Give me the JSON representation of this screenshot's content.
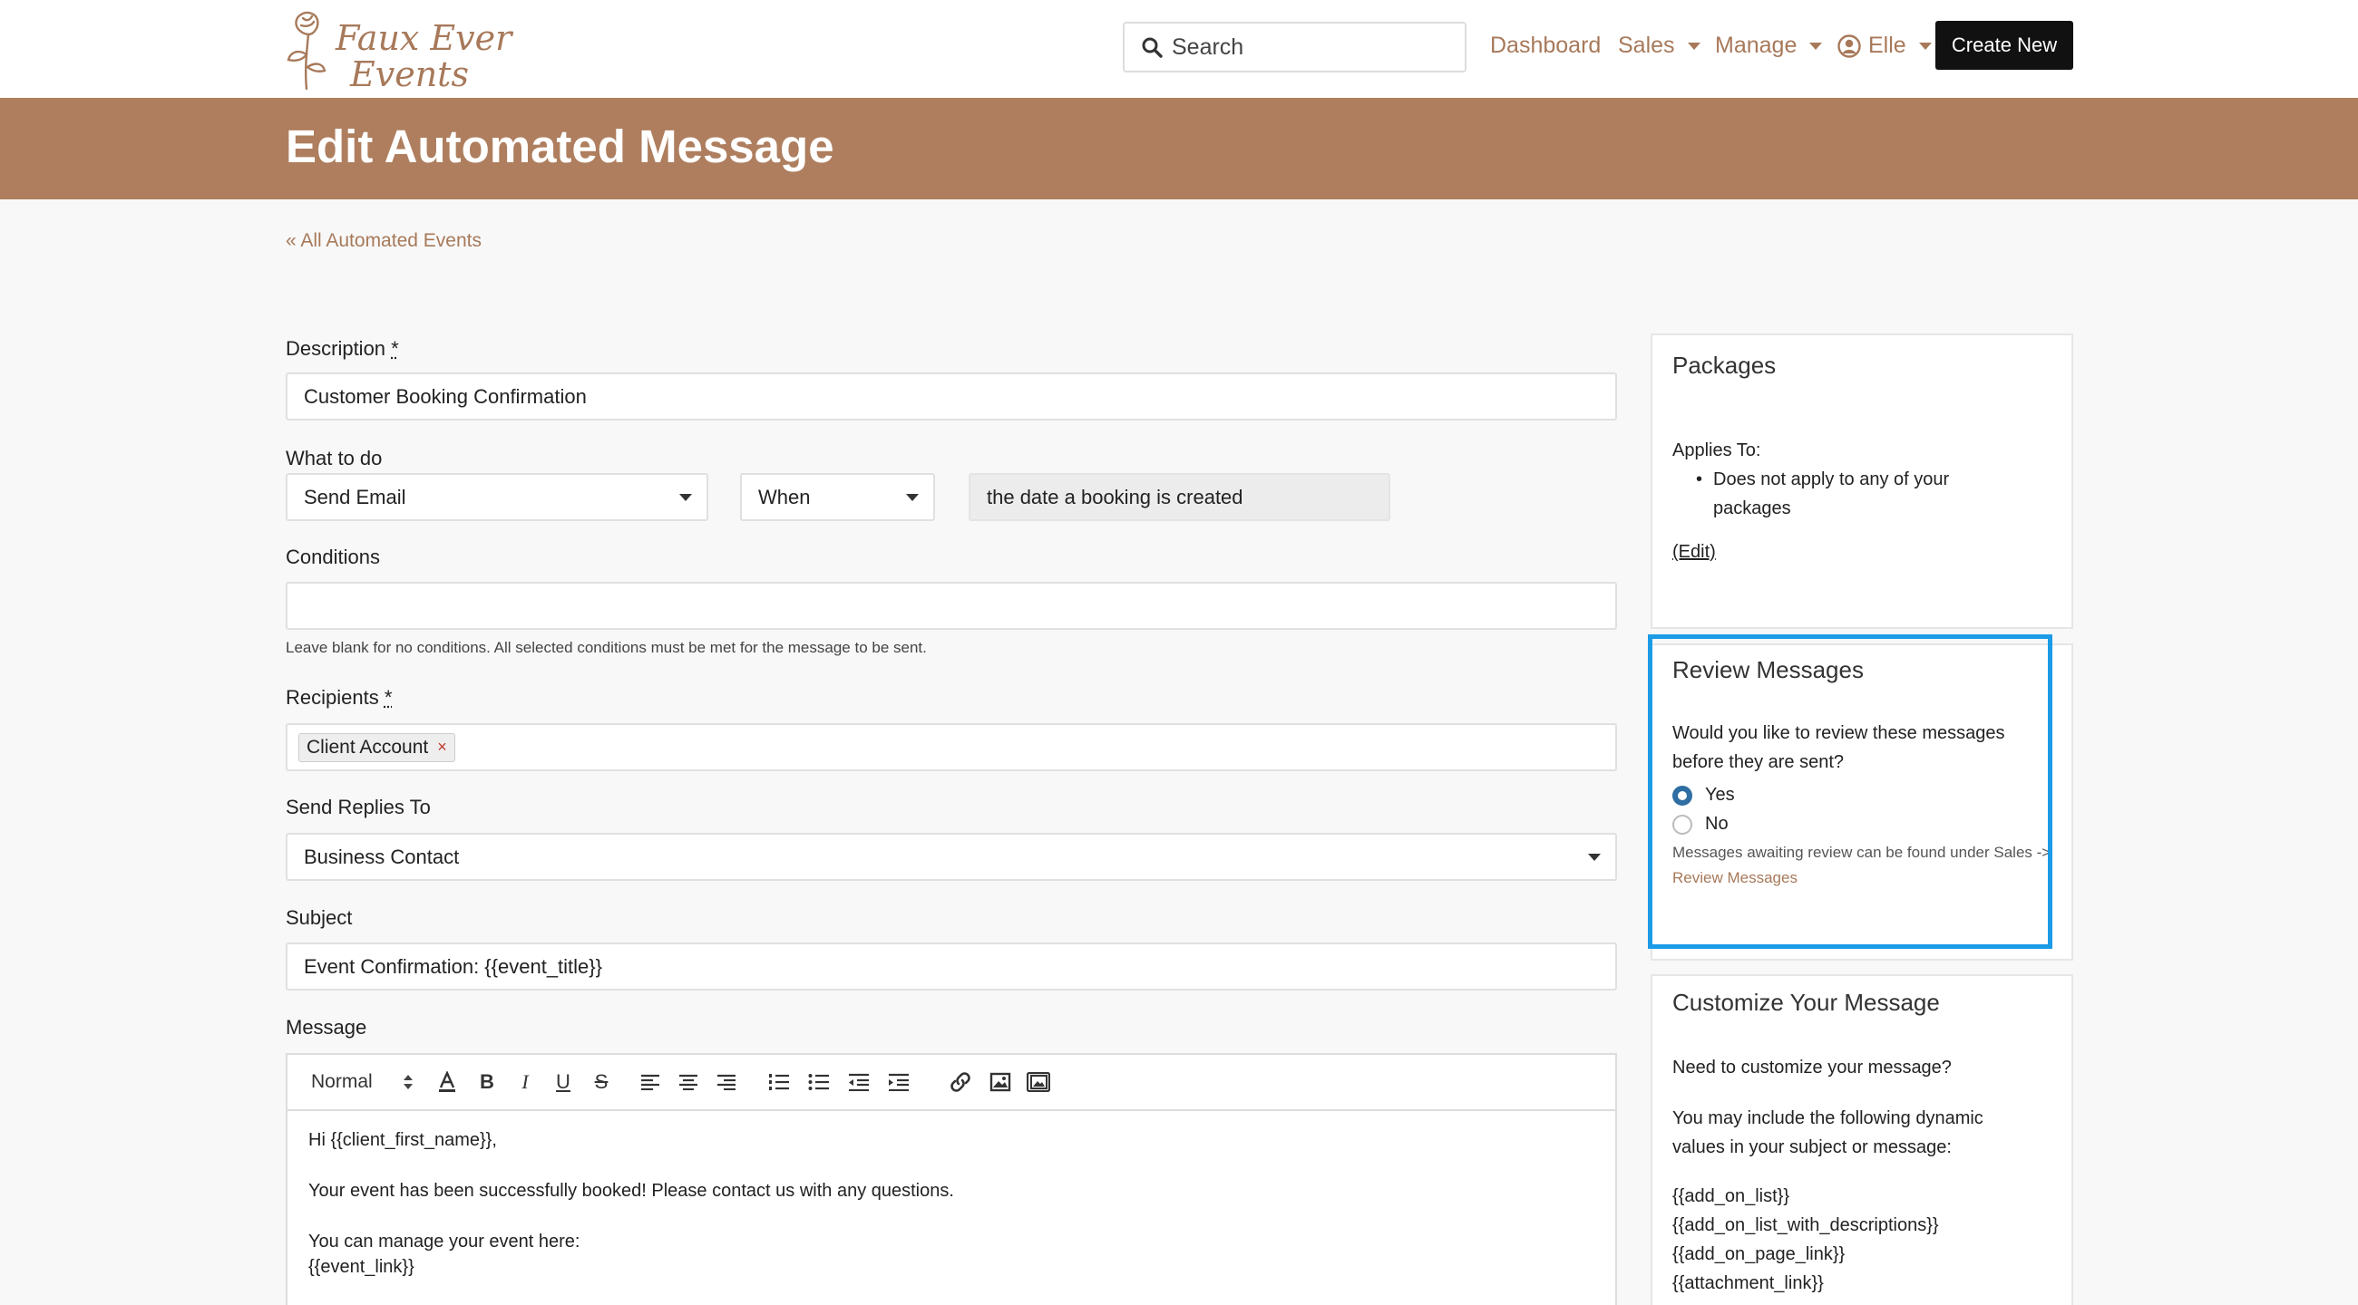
{
  "brand": {
    "logo_line1": "Faux Ever",
    "logo_line2": "Events"
  },
  "nav": {
    "search_placeholder": "Search",
    "dashboard": "Dashboard",
    "sales": "Sales",
    "manage": "Manage",
    "user": "Elle",
    "create_new": "Create New"
  },
  "page": {
    "title": "Edit Automated Message",
    "back_link": "« All Automated Events"
  },
  "form": {
    "description": {
      "label": "Description",
      "required_mark": "*",
      "value": "Customer Booking Confirmation"
    },
    "what_to_do": {
      "label": "What to do",
      "action": "Send Email",
      "timing": "When",
      "trigger": "the date a booking is created"
    },
    "conditions": {
      "label": "Conditions",
      "value": "",
      "help": "Leave blank for no conditions. All selected conditions must be met for the message to be sent."
    },
    "recipients": {
      "label": "Recipients",
      "required_mark": "*",
      "tags": [
        "Client Account"
      ],
      "remove_symbol": "×"
    },
    "send_replies_to": {
      "label": "Send Replies To",
      "value": "Business Contact"
    },
    "subject": {
      "label": "Subject",
      "value": "Event Confirmation: {{event_title}}"
    },
    "message": {
      "label": "Message",
      "format": "Normal",
      "body_lines": [
        "Hi {{client_first_name}},",
        "",
        "Your event has been successfully booked! Please contact us with any questions.",
        "",
        "You can manage your event here:",
        "{{event_link}}"
      ]
    }
  },
  "sidebar": {
    "packages": {
      "title": "Packages",
      "applies_to": "Applies To:",
      "bullet": "Does not apply to any of your packages",
      "edit_link": "(Edit)"
    },
    "review": {
      "title": "Review Messages",
      "question": "Would you like to review these messages before they are sent?",
      "options": [
        "Yes",
        "No"
      ],
      "selected": "Yes",
      "note_prefix": "Messages awaiting review can be found under Sales ->",
      "note_link": "Review Messages"
    },
    "customize": {
      "title": "Customize Your Message",
      "intro": "Need to customize your message?",
      "explain": "You may include the following dynamic values in your subject or message:",
      "values": [
        "{{add_on_list}}",
        "{{add_on_list_with_descriptions}}",
        "{{add_on_page_link}}",
        "{{attachment_link}}"
      ]
    }
  },
  "colors": {
    "brand": "#a7795a",
    "banner": "#ae7e5e",
    "highlight": "#1c9be6",
    "radio_on": "#2f6ea3"
  }
}
